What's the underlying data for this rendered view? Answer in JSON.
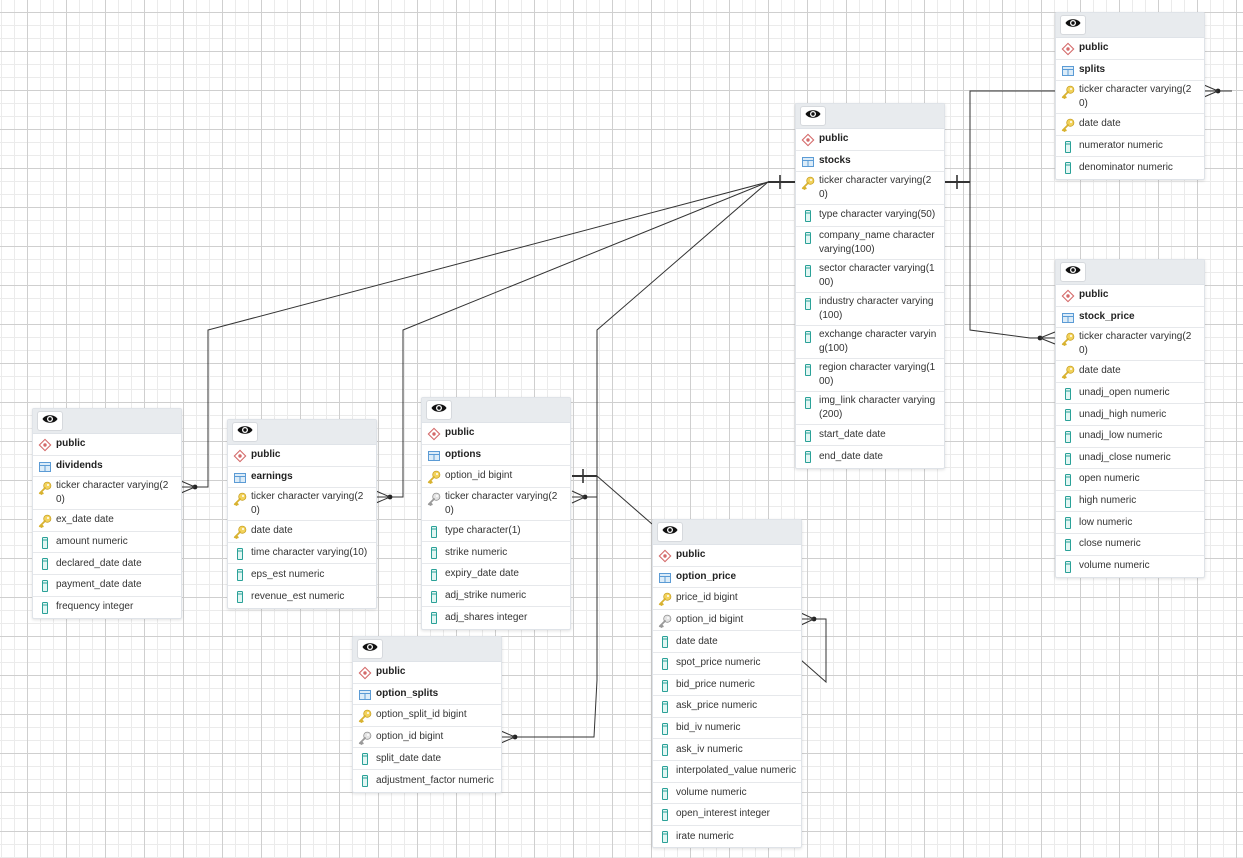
{
  "diagram": {
    "type": "entity-relationship",
    "header_button": "toggle-visibility",
    "colors": {
      "schema_icon": "#d46a6a",
      "table_icon": "#5b9bd5",
      "primary_key": "#e6c02e",
      "foreign_key": "#9a9a9a",
      "column_icon": "#2aa198",
      "header_bg": "#e8ebee"
    }
  },
  "tables": [
    {
      "schema": "public",
      "name": "stocks",
      "schema_icon": "schema",
      "table_icon": "table",
      "columns": [
        {
          "text": "ticker character varying(20)",
          "icon": "primary-key"
        },
        {
          "text": "type character varying(50)",
          "icon": "column"
        },
        {
          "text": "company_name character varying(100)",
          "icon": "column"
        },
        {
          "text": "sector character varying(100)",
          "icon": "column"
        },
        {
          "text": "industry character varying (100)",
          "icon": "column"
        },
        {
          "text": "exchange character varying(100)",
          "icon": "column"
        },
        {
          "text": "region character varying(100)",
          "icon": "column"
        },
        {
          "text": "img_link character varying (200)",
          "icon": "column"
        },
        {
          "text": "start_date date",
          "icon": "column"
        },
        {
          "text": "end_date date",
          "icon": "column"
        }
      ]
    },
    {
      "schema": "public",
      "name": "splits",
      "schema_icon": "schema",
      "table_icon": "table",
      "columns": [
        {
          "text": "ticker character varying(20)",
          "icon": "primary-key"
        },
        {
          "text": "date date",
          "icon": "primary-key"
        },
        {
          "text": "numerator numeric",
          "icon": "column"
        },
        {
          "text": "denominator numeric",
          "icon": "column"
        }
      ]
    },
    {
      "schema": "public",
      "name": "stock_price",
      "schema_icon": "schema",
      "table_icon": "table",
      "columns": [
        {
          "text": "ticker character varying(20)",
          "icon": "primary-key"
        },
        {
          "text": "date date",
          "icon": "primary-key"
        },
        {
          "text": "unadj_open numeric",
          "icon": "column"
        },
        {
          "text": "unadj_high numeric",
          "icon": "column"
        },
        {
          "text": "unadj_low numeric",
          "icon": "column"
        },
        {
          "text": "unadj_close numeric",
          "icon": "column"
        },
        {
          "text": "open numeric",
          "icon": "column"
        },
        {
          "text": "high numeric",
          "icon": "column"
        },
        {
          "text": "low numeric",
          "icon": "column"
        },
        {
          "text": "close numeric",
          "icon": "column"
        },
        {
          "text": "volume numeric",
          "icon": "column"
        }
      ]
    },
    {
      "schema": "public",
      "name": "dividends",
      "schema_icon": "schema",
      "table_icon": "table",
      "columns": [
        {
          "text": "ticker character varying(20)",
          "icon": "primary-key"
        },
        {
          "text": "ex_date date",
          "icon": "primary-key"
        },
        {
          "text": "amount numeric",
          "icon": "column"
        },
        {
          "text": "declared_date date",
          "icon": "column"
        },
        {
          "text": "payment_date date",
          "icon": "column"
        },
        {
          "text": "frequency integer",
          "icon": "column"
        }
      ]
    },
    {
      "schema": "public",
      "name": "earnings",
      "schema_icon": "schema",
      "table_icon": "table",
      "columns": [
        {
          "text": "ticker character varying(20)",
          "icon": "primary-key"
        },
        {
          "text": "date date",
          "icon": "primary-key"
        },
        {
          "text": "time character varying(10)",
          "icon": "column"
        },
        {
          "text": "eps_est numeric",
          "icon": "column"
        },
        {
          "text": "revenue_est numeric",
          "icon": "column"
        }
      ]
    },
    {
      "schema": "public",
      "name": "options",
      "schema_icon": "schema",
      "table_icon": "table",
      "columns": [
        {
          "text": "option_id bigint",
          "icon": "primary-key"
        },
        {
          "text": "ticker character varying(20)",
          "icon": "foreign-key"
        },
        {
          "text": "type character(1)",
          "icon": "column"
        },
        {
          "text": "strike numeric",
          "icon": "column"
        },
        {
          "text": "expiry_date date",
          "icon": "column"
        },
        {
          "text": "adj_strike numeric",
          "icon": "column"
        },
        {
          "text": "adj_shares integer",
          "icon": "column"
        }
      ]
    },
    {
      "schema": "public",
      "name": "option_splits",
      "schema_icon": "schema",
      "table_icon": "table",
      "columns": [
        {
          "text": "option_split_id bigint",
          "icon": "primary-key"
        },
        {
          "text": "option_id bigint",
          "icon": "foreign-key"
        },
        {
          "text": "split_date date",
          "icon": "column"
        },
        {
          "text": "adjustment_factor numeric",
          "icon": "column"
        }
      ]
    },
    {
      "schema": "public",
      "name": "option_price",
      "schema_icon": "schema",
      "table_icon": "table",
      "columns": [
        {
          "text": "price_id bigint",
          "icon": "primary-key"
        },
        {
          "text": "option_id bigint",
          "icon": "foreign-key"
        },
        {
          "text": "date date",
          "icon": "column"
        },
        {
          "text": "spot_price numeric",
          "icon": "column"
        },
        {
          "text": "bid_price numeric",
          "icon": "column"
        },
        {
          "text": "ask_price numeric",
          "icon": "column"
        },
        {
          "text": "bid_iv numeric",
          "icon": "column"
        },
        {
          "text": "ask_iv numeric",
          "icon": "column"
        },
        {
          "text": "interpolated_value numeric",
          "icon": "column"
        },
        {
          "text": "volume numeric",
          "icon": "column"
        },
        {
          "text": "open_interest integer",
          "icon": "column"
        },
        {
          "text": "irate numeric",
          "icon": "column"
        }
      ]
    }
  ],
  "relationships": [
    {
      "from": "stocks.ticker",
      "to": "dividends.ticker",
      "cardinality": "one-to-many"
    },
    {
      "from": "stocks.ticker",
      "to": "earnings.ticker",
      "cardinality": "one-to-many"
    },
    {
      "from": "stocks.ticker",
      "to": "options.ticker",
      "cardinality": "one-to-many"
    },
    {
      "from": "stocks.ticker",
      "to": "splits.ticker",
      "cardinality": "one-to-many"
    },
    {
      "from": "stocks.ticker",
      "to": "stock_price.ticker",
      "cardinality": "one-to-many"
    },
    {
      "from": "options.option_id",
      "to": "option_splits.option_id",
      "cardinality": "one-to-many"
    },
    {
      "from": "options.option_id",
      "to": "option_price.option_id",
      "cardinality": "one-to-many"
    }
  ]
}
